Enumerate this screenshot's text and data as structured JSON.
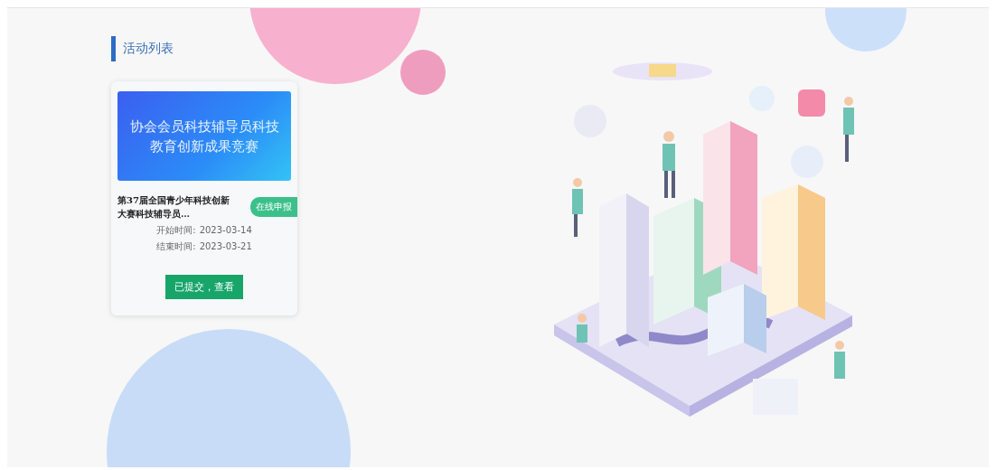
{
  "section_title": "活动列表",
  "activities": [
    {
      "banner_text": "协会会员科技辅导员科技教育创新成果竞赛",
      "title": "第37届全国青少年科技创新大赛科技辅导员…",
      "badge": "在线申报",
      "start_label": "开始时间:",
      "start_date": "2023-03-14",
      "end_label": "结束时间:",
      "end_date": "2023-03-21",
      "action": "已提交，查看"
    }
  ]
}
